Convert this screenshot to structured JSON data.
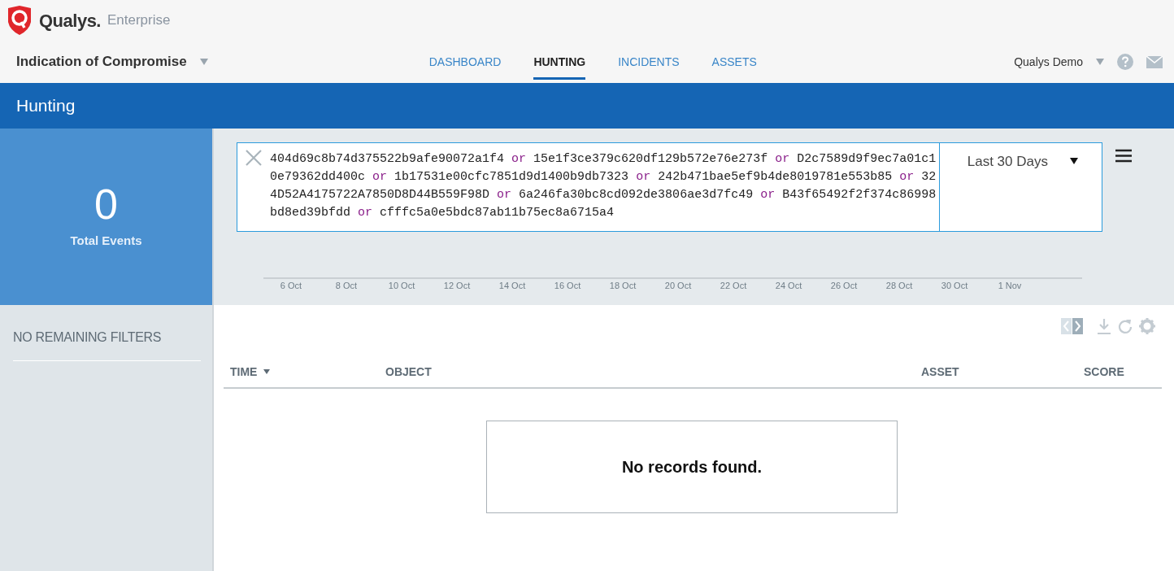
{
  "brand": {
    "name": "Qualys.",
    "product": "Enterprise"
  },
  "app": {
    "title": "Indication of Compromise"
  },
  "nav": [
    {
      "label": "DASHBOARD",
      "selected": false
    },
    {
      "label": "HUNTING",
      "selected": true
    },
    {
      "label": "INCIDENTS",
      "selected": false
    },
    {
      "label": "ASSETS",
      "selected": false
    }
  ],
  "user": {
    "name": "Qualys Demo"
  },
  "page": {
    "title": "Hunting"
  },
  "summary": {
    "count": "0",
    "label": "Total Events"
  },
  "query": [
    {
      "text": "404d69c8b74d375522b9afe90072a1f4",
      "kind": "term"
    },
    {
      "text": "or",
      "kind": "operator"
    },
    {
      "text": "15e1f3ce379c620df129b572e76e273f",
      "kind": "term"
    },
    {
      "text": "or",
      "kind": "operator"
    },
    {
      "text": "D2c7589d9f9ec7a01c10e79362dd400c",
      "kind": "term"
    },
    {
      "text": "or",
      "kind": "operator"
    },
    {
      "text": "1b17531e00cfc7851d9d1400b9db7323",
      "kind": "term"
    },
    {
      "text": "or",
      "kind": "operator"
    },
    {
      "text": "242b471bae5ef9b4de8019781e553b85",
      "kind": "term"
    },
    {
      "text": "or",
      "kind": "operator"
    },
    {
      "text": "324D52A4175722A7850D8D44B559F98D",
      "kind": "term"
    },
    {
      "text": "or",
      "kind": "operator"
    },
    {
      "text": "6a246fa30bc8cd092de3806ae3d7fc49",
      "kind": "term"
    },
    {
      "text": "or",
      "kind": "operator"
    },
    {
      "text": "B43f65492f2f374c86998bd8ed39bfdd",
      "kind": "term"
    },
    {
      "text": "or",
      "kind": "operator"
    },
    {
      "text": "cfffc5a0e5bdc87ab11b75ec8a6715a4",
      "kind": "term"
    }
  ],
  "date_range": {
    "value": "Last 30 Days"
  },
  "timeline": {
    "labels": [
      "6 Oct",
      "8 Oct",
      "10 Oct",
      "12 Oct",
      "14 Oct",
      "16 Oct",
      "18 Oct",
      "20 Oct",
      "22 Oct",
      "24 Oct",
      "26 Oct",
      "28 Oct",
      "30 Oct",
      "1 Nov"
    ]
  },
  "filters": {
    "title": "NO REMAINING FILTERS"
  },
  "table": {
    "columns": [
      {
        "label": "TIME",
        "sorted": true
      },
      {
        "label": "OBJECT",
        "sorted": false
      },
      {
        "label": "ASSET",
        "sorted": false
      },
      {
        "label": "SCORE",
        "sorted": false
      }
    ],
    "empty_message": "No records found."
  }
}
